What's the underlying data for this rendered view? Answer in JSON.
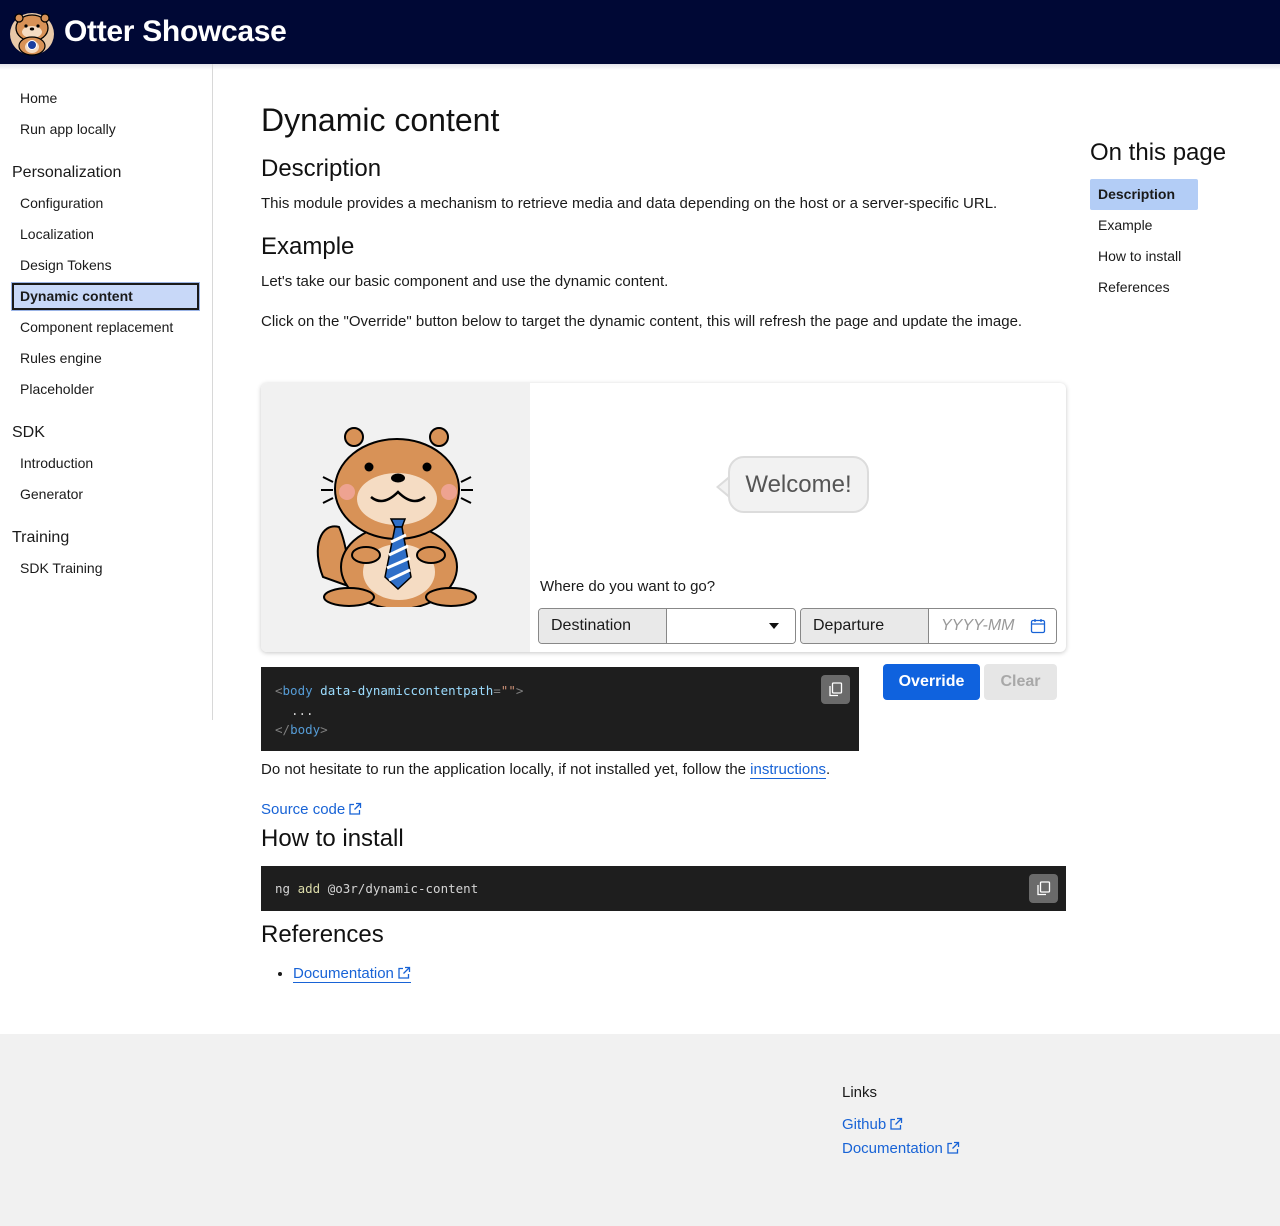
{
  "header": {
    "brand": "Otter Showcase",
    "logo_icon": "otter-logo"
  },
  "sidebar": {
    "top_items": [
      {
        "label": "Home"
      },
      {
        "label": "Run app locally"
      }
    ],
    "groups": [
      {
        "title": "Personalization",
        "items": [
          "Configuration",
          "Localization",
          "Design Tokens",
          "Dynamic content",
          "Component replacement",
          "Rules engine",
          "Placeholder"
        ]
      },
      {
        "title": "SDK",
        "items": [
          "Introduction",
          "Generator"
        ]
      },
      {
        "title": "Training",
        "items": [
          "SDK Training"
        ]
      }
    ],
    "active_item": "Dynamic content"
  },
  "main": {
    "title": "Dynamic content",
    "description_heading": "Description",
    "description_text": "This module provides a mechanism to retrieve media and data depending on the host or a server-specific URL.",
    "example_heading": "Example",
    "example_text_1": "Let's take our basic component and use the dynamic content.",
    "example_text_2": "Click on the \"Override\" button below to target the dynamic content, this will refresh the page and update the image.",
    "demo": {
      "bubble_text": "Welcome!",
      "question": "Where do you want to go?",
      "destination_label": "Destination",
      "departure_label": "Departure",
      "date_placeholder": "YYYY-MM"
    },
    "code_sample": {
      "line1_open": "<",
      "line1_tag": "body",
      "line1_attr": "data-dynamiccontentpath",
      "line1_eq": "=",
      "line1_val": "\"\"",
      "line1_close": ">",
      "line2": "...",
      "line3_open": "</",
      "line3_tag": "body",
      "line3_close": ">"
    },
    "override_button": "Override",
    "clear_button": "Clear",
    "run_locally_text": "Do not hesitate to run the application locally, if not installed yet, follow the ",
    "run_locally_link": "instructions",
    "run_locally_end": ".",
    "source_code_link": "Source code",
    "install_heading": "How to install",
    "install_cmd": {
      "cmd": "ng",
      "sub": "add",
      "pkg": "@o3r/dynamic-content"
    },
    "references_heading": "References",
    "references": [
      "Documentation"
    ]
  },
  "toc": {
    "title": "On this page",
    "items": [
      "Description",
      "Example",
      "How to install",
      "References"
    ],
    "active": "Description"
  },
  "footer": {
    "links_title": "Links",
    "links": [
      "Github",
      "Documentation"
    ]
  },
  "colors": {
    "topbar": "#000835",
    "accent": "#0f62de",
    "link": "#1863d6",
    "active_bg": "#c8d8f8"
  }
}
